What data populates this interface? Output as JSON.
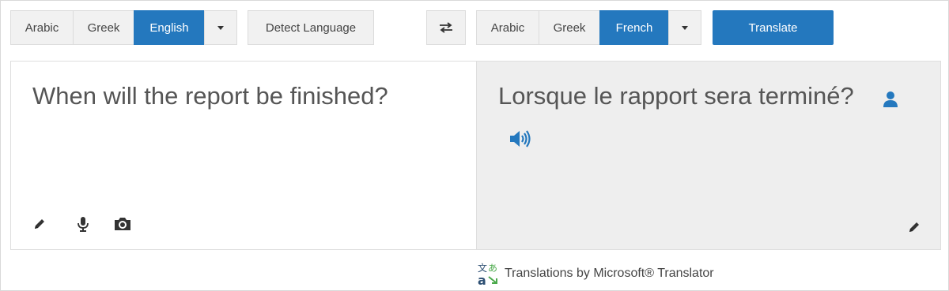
{
  "source_lang_bar": {
    "options": [
      "Arabic",
      "Greek",
      "English"
    ],
    "selected": "English",
    "more_label": "more-languages"
  },
  "detect_button": {
    "label": "Detect Language"
  },
  "swap_button": {
    "icon": "swap-arrows-icon"
  },
  "target_lang_bar": {
    "options": [
      "Arabic",
      "Greek",
      "French"
    ],
    "selected": "French",
    "more_label": "more-languages"
  },
  "translate_button": {
    "label": "Translate"
  },
  "source_panel": {
    "text": "When will the report be finished?",
    "icons": [
      "pencil-icon",
      "microphone-icon",
      "camera-icon"
    ]
  },
  "target_panel": {
    "text": "Lorsque le rapport sera terminé?",
    "icons": [
      "user-icon",
      "speaker-icon",
      "pencil-icon"
    ]
  },
  "footer": {
    "text": "Translations by Microsoft® Translator",
    "icon": "translator-logo-icon"
  },
  "colors": {
    "accent": "#2478be",
    "button_bg": "#f1f1f1",
    "output_bg": "#eeeeee"
  }
}
